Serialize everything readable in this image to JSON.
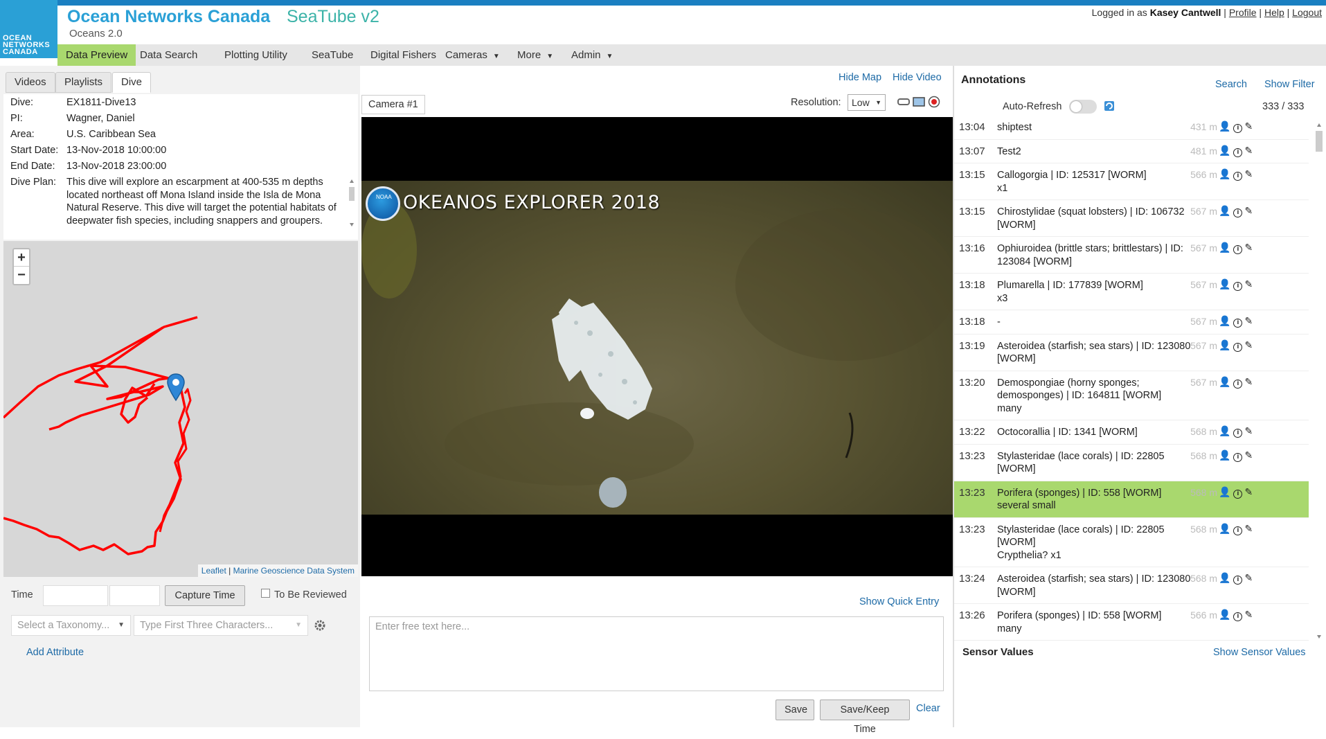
{
  "header": {
    "logo_text": "OCEAN\nNETWORKS\nCANADA",
    "brand": "Ocean Networks Canada",
    "app": "SeaTube v2",
    "subtitle": "Oceans 2.0",
    "logged_in_prefix": "Logged in as",
    "user": "Kasey Cantwell",
    "links": [
      "Profile",
      "Help",
      "Logout"
    ]
  },
  "nav": [
    {
      "label": "Data Preview",
      "active": true
    },
    {
      "label": "Data Search"
    },
    {
      "label": "Plotting Utility"
    },
    {
      "label": "SeaTube"
    },
    {
      "label": "Digital Fishers"
    },
    {
      "label": "Cameras",
      "caret": true
    },
    {
      "label": "More",
      "caret": true
    },
    {
      "label": "Admin",
      "caret": true
    }
  ],
  "left_tabs": [
    "Videos",
    "Playlists",
    "Dive"
  ],
  "dive": {
    "dive_label": "Dive:",
    "dive": "EX1811-Dive13",
    "pi_label": "PI:",
    "pi": "Wagner, Daniel",
    "area_label": "Area:",
    "area": "U.S. Caribbean Sea",
    "start_label": "Start Date:",
    "start": "13-Nov-2018 10:00:00",
    "end_label": "End Date:",
    "end": "13-Nov-2018 23:00:00",
    "plan_label": "Dive Plan:",
    "plan": "This dive will explore an escarpment at 400-535 m depths located northeast off Mona Island inside the Isla de Mona Natural Reserve. This dive will target the potential habitats of deepwater fish species, including snappers and groupers."
  },
  "map": {
    "zoom_in": "+",
    "zoom_out": "−",
    "attribution_a": "Leaflet",
    "attribution_b": "Marine Geoscience Data System"
  },
  "form": {
    "time_label": "Time",
    "capture_time": "Capture Time",
    "to_be_reviewed": "To Be Reviewed",
    "taxonomy_placeholder": "Select a Taxonomy...",
    "type_placeholder": "Type First Three Characters...",
    "add_attribute": "Add Attribute",
    "show_quick_entry": "Show Quick Entry",
    "free_text_placeholder": "Enter free text here...",
    "save": "Save",
    "save_keep": "Save/Keep Time",
    "clear": "Clear"
  },
  "video": {
    "hide_map": "Hide Map",
    "hide_video": "Hide Video",
    "camera_tab": "Camera #1",
    "resolution_label": "Resolution:",
    "resolution_value": "Low",
    "overlay_title": "OKEANOS EXPLORER 2018",
    "noaa_label": "NOAA"
  },
  "annotations": {
    "title": "Annotations",
    "search": "Search",
    "show_filter": "Show Filter",
    "auto_refresh": "Auto-Refresh",
    "count": "333 / 333",
    "rows": [
      {
        "time": "13:04",
        "text": "shiptest",
        "depth": "431 m"
      },
      {
        "time": "13:07",
        "text": "Test2",
        "depth": "481 m"
      },
      {
        "time": "13:15",
        "text": "Callogorgia | ID: 125317 [WORM]\nx1",
        "depth": "566 m"
      },
      {
        "time": "13:15",
        "text": "Chirostylidae (squat lobsters) | ID: 106732 [WORM]",
        "depth": "567 m"
      },
      {
        "time": "13:16",
        "text": "Ophiuroidea (brittle stars; brittlestars) | ID: 123084 [WORM]",
        "depth": "567 m"
      },
      {
        "time": "13:18",
        "text": "Plumarella | ID: 177839 [WORM]\nx3",
        "depth": "567 m"
      },
      {
        "time": "13:18",
        "text": "-",
        "depth": "567 m"
      },
      {
        "time": "13:19",
        "text": "Asteroidea (starfish; sea stars) | ID: 123080 [WORM]",
        "depth": "567 m"
      },
      {
        "time": "13:20",
        "text": "Demospongiae (horny sponges; demosponges) | ID: 164811 [WORM]\nmany",
        "depth": "567 m"
      },
      {
        "time": "13:22",
        "text": "Octocorallia | ID: 1341 [WORM]",
        "depth": "568 m"
      },
      {
        "time": "13:23",
        "text": "Stylasteridae (lace corals) | ID: 22805 [WORM]",
        "depth": "568 m"
      },
      {
        "time": "13:23",
        "text": "Porifera (sponges) | ID: 558 [WORM]\nseveral small",
        "depth": "568 m",
        "highlight": true
      },
      {
        "time": "13:23",
        "text": "Stylasteridae (lace corals) | ID: 22805 [WORM]\nCrypthelia? x1",
        "depth": "568 m"
      },
      {
        "time": "13:24",
        "text": "Asteroidea (starfish; sea stars) | ID: 123080 [WORM]",
        "depth": "568 m"
      },
      {
        "time": "13:26",
        "text": "Porifera (sponges) | ID: 558 [WORM]\nmany",
        "depth": "566 m"
      }
    ],
    "sensor_title": "Sensor Values",
    "show_sensor": "Show Sensor Values"
  }
}
